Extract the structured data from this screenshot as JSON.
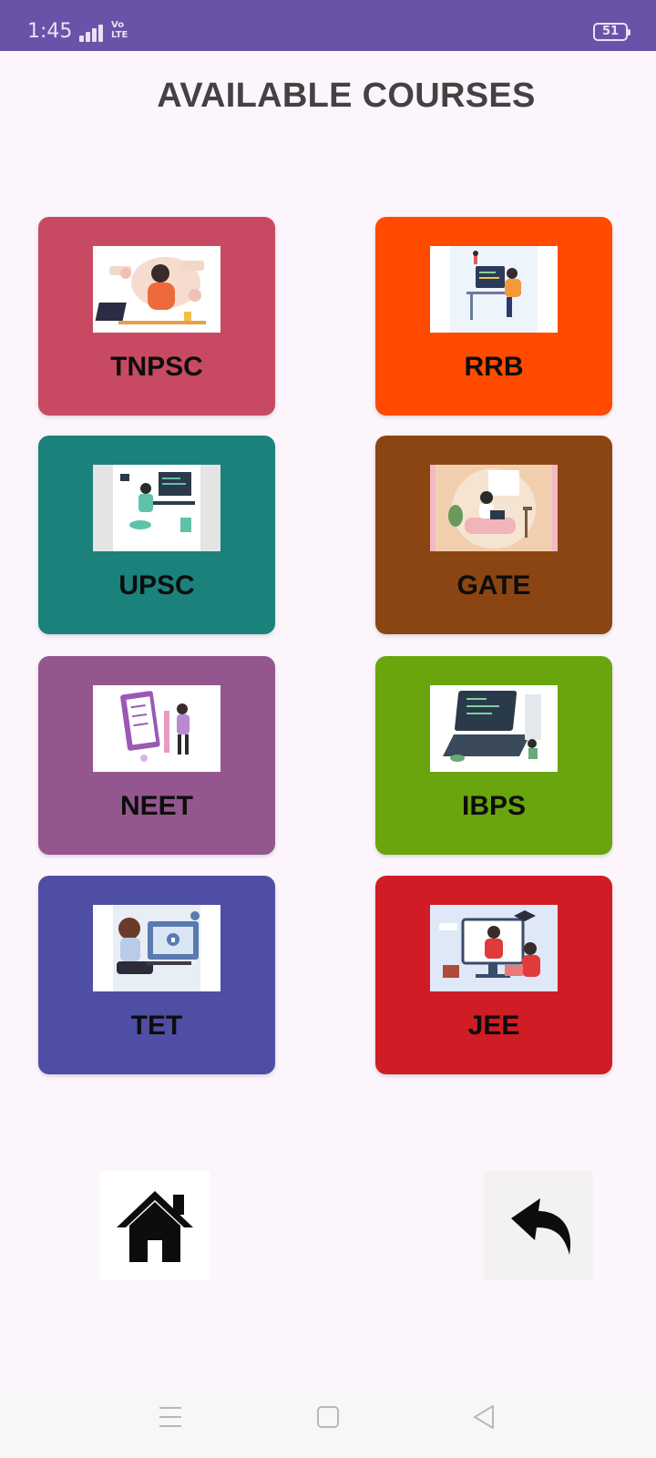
{
  "status_bar": {
    "time": "1:45",
    "network_label": "Vo\nLTE",
    "battery": "51",
    "background": "#6a52a8"
  },
  "page": {
    "title": "AVAILABLE COURSES"
  },
  "courses": [
    {
      "label": "TNPSC",
      "color": "#c84a62",
      "icon": "woman-laptop-illustration"
    },
    {
      "label": "RRB",
      "color": "#ff4a00",
      "icon": "developer-desk-illustration"
    },
    {
      "label": "UPSC",
      "color": "#1a827a",
      "icon": "programmer-workstation-illustration"
    },
    {
      "label": "GATE",
      "color": "#8b4512",
      "icon": "woman-sofa-laptop-illustration"
    },
    {
      "label": "NEET",
      "color": "#94568f",
      "icon": "checklist-clipboard-illustration"
    },
    {
      "label": "IBPS",
      "color": "#69a50c",
      "icon": "laptop-code-illustration"
    },
    {
      "label": "TET",
      "color": "#4f4ea5",
      "icon": "woman-security-computer-illustration"
    },
    {
      "label": "JEE",
      "color": "#d01c24",
      "icon": "online-class-illustration"
    }
  ],
  "bottom_actions": {
    "home_icon": "home-icon",
    "back_icon": "back-arrow-icon"
  },
  "nav_bar": {
    "icons": [
      "menu-icon",
      "home-square-icon",
      "back-triangle-icon"
    ]
  }
}
